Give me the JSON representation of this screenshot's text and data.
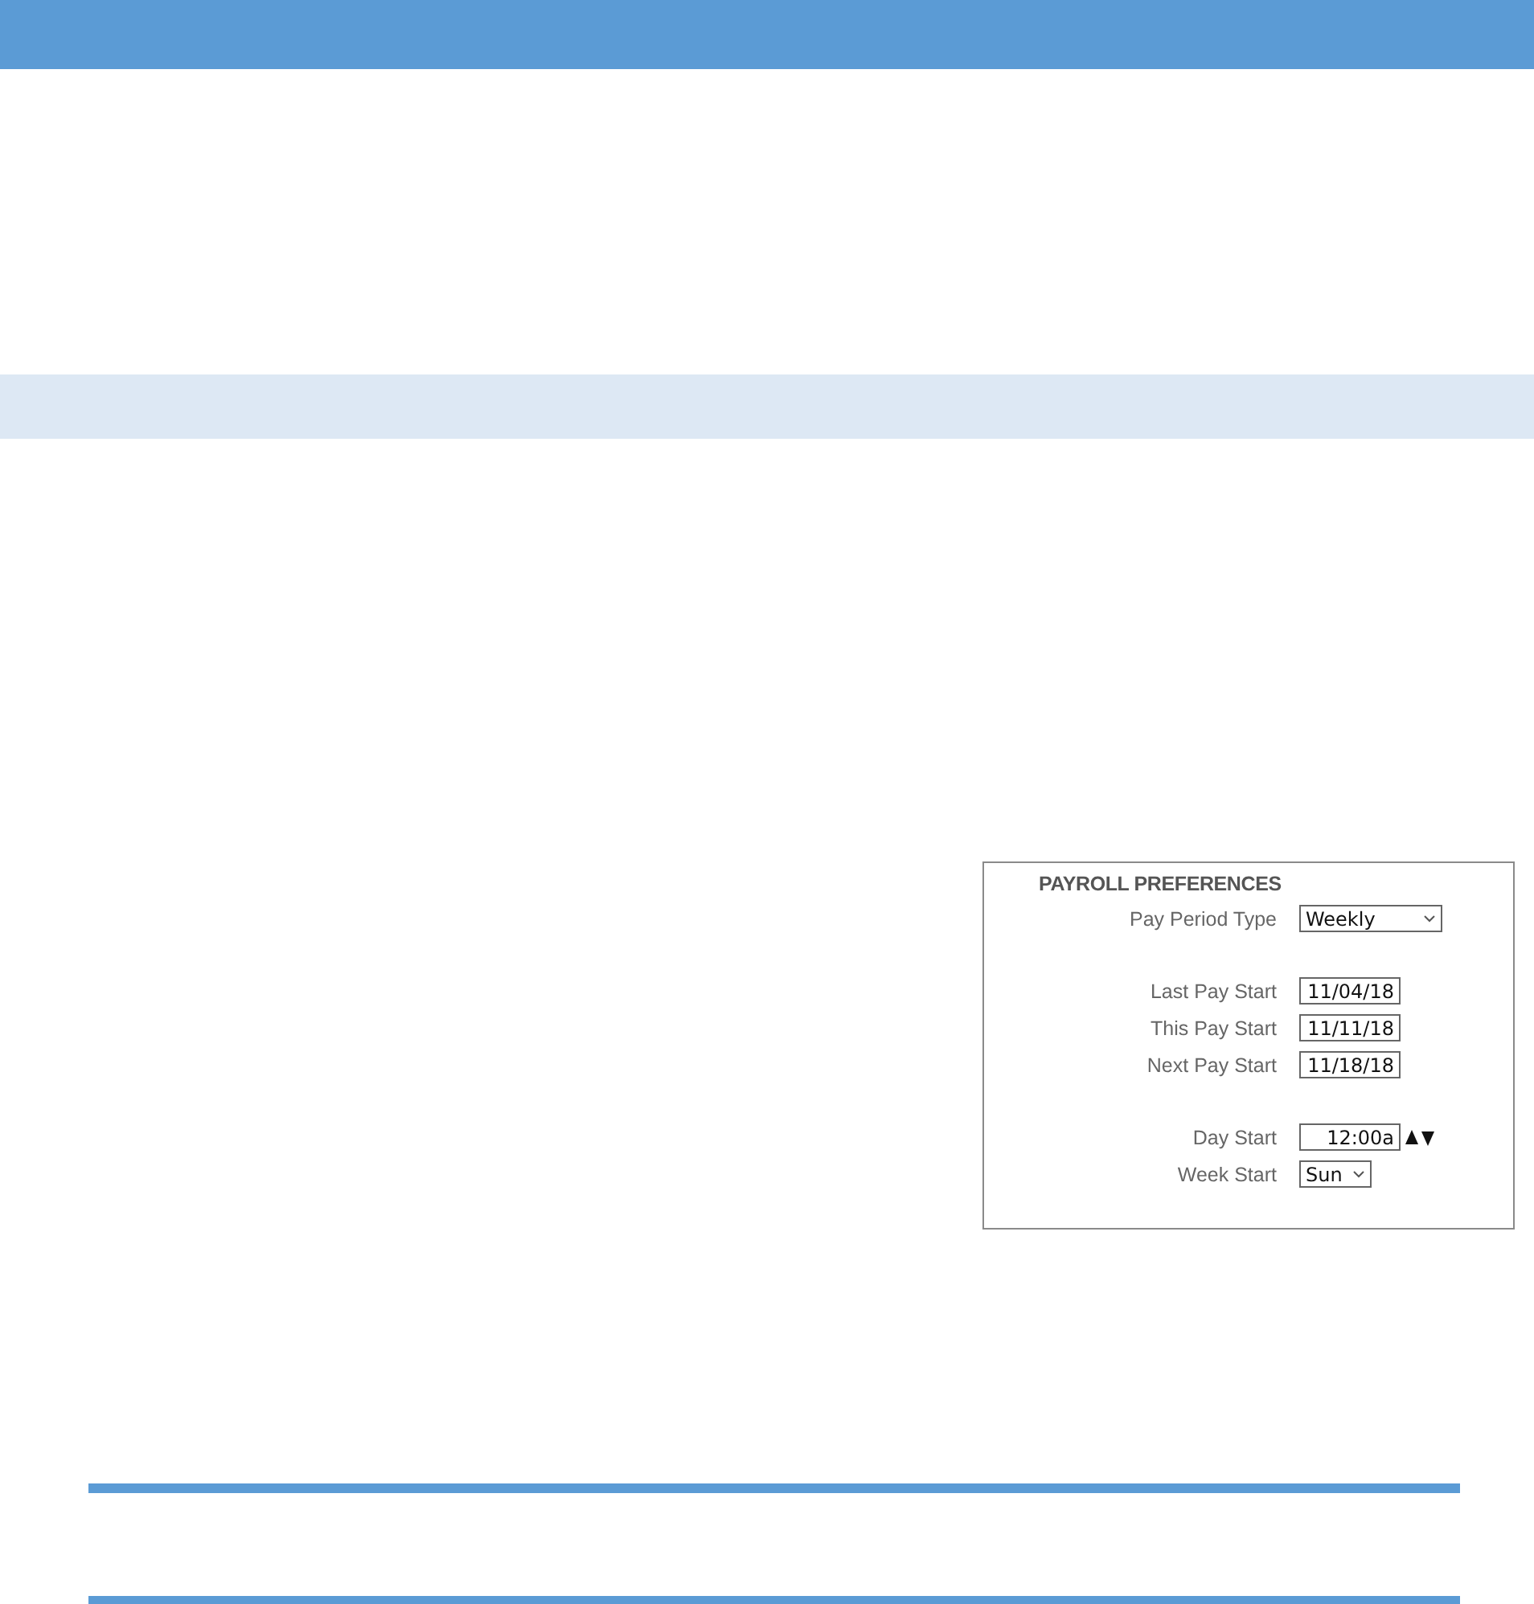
{
  "payroll_preferences": {
    "title": "PAYROLL PREFERENCES",
    "groups": [
      [
        {
          "label": "Pay Period Type",
          "kind": "select",
          "value": "Weekly"
        }
      ],
      [
        {
          "label": "Last Pay Start",
          "kind": "date",
          "value": "11/04/18"
        },
        {
          "label": "This Pay Start",
          "kind": "date",
          "value": "11/11/18"
        },
        {
          "label": "Next Pay Start",
          "kind": "date",
          "value": "11/18/18"
        }
      ],
      [
        {
          "label": "Day Start",
          "kind": "time",
          "value": "12:00a"
        },
        {
          "label": "Week Start",
          "kind": "small-select",
          "value": "Sun"
        }
      ]
    ]
  }
}
